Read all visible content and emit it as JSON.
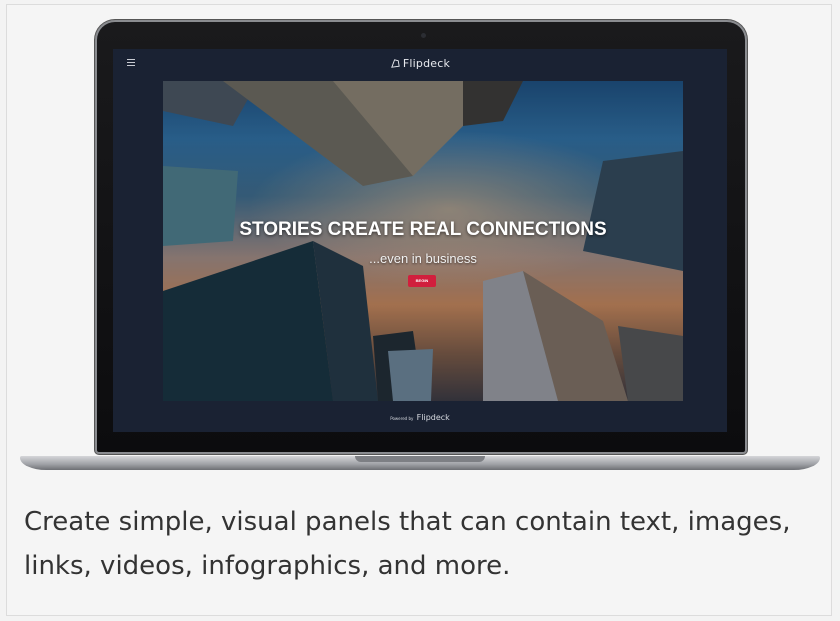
{
  "screen": {
    "brand": "Flipdeck",
    "hero": {
      "title": "STORIES CREATE REAL CONNECTIONS",
      "subtitle": "...even in business",
      "button": "BEGIN"
    },
    "footer": {
      "powered_by": "Powered by",
      "brand": "Flipdeck"
    },
    "icons": {
      "menu": "hamburger-menu-icon",
      "brand": "flipdeck-logo-icon"
    },
    "colors": {
      "button": "#d11f3d",
      "screen_bg": "#1a2233"
    }
  },
  "caption": "Create simple, visual panels that can contain text, images, links, videos, infographics, and more."
}
